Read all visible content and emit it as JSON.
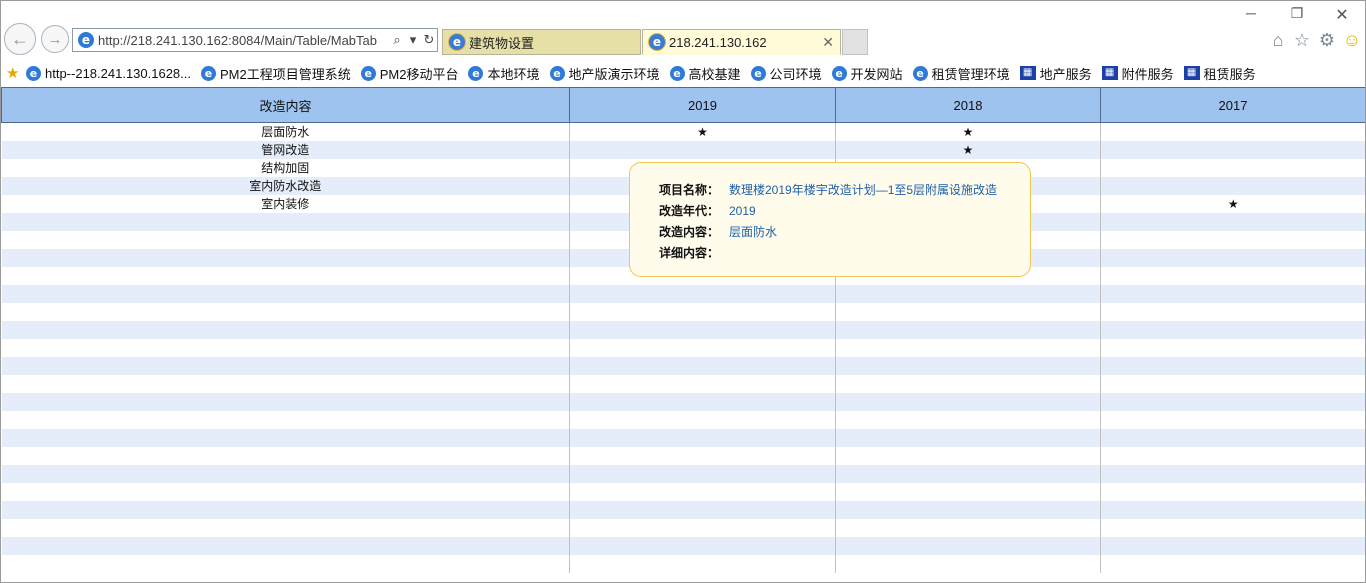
{
  "browser": {
    "address": "http://218.241.130.162:8084/Main/Table/MabTab",
    "tabs": [
      {
        "label": "建筑物设置"
      },
      {
        "label": "218.241.130.162"
      }
    ],
    "favorites": [
      {
        "label": "http--218.241.130.1628...",
        "icon": "ie-icon"
      },
      {
        "label": "PM2工程项目管理系统",
        "icon": "ie-icon"
      },
      {
        "label": "PM2移动平台",
        "icon": "ie-icon"
      },
      {
        "label": "本地环境",
        "icon": "ie-icon"
      },
      {
        "label": "地产版演示环境",
        "icon": "ie-icon"
      },
      {
        "label": "高校基建",
        "icon": "ie-icon"
      },
      {
        "label": "公司环境",
        "icon": "ie-icon"
      },
      {
        "label": "开发网站",
        "icon": "ie-icon"
      },
      {
        "label": "租赁管理环境",
        "icon": "ie-icon"
      },
      {
        "label": "地产服务",
        "icon": "service-icon"
      },
      {
        "label": "附件服务",
        "icon": "service-icon"
      },
      {
        "label": "租赁服务",
        "icon": "service-icon"
      }
    ]
  },
  "table": {
    "headers": [
      "改造内容",
      "2019",
      "2018",
      "2017"
    ],
    "rows": [
      {
        "name": "层面防水",
        "y2019": "★",
        "y2018": "★",
        "y2017": ""
      },
      {
        "name": "管网改造",
        "y2019": "",
        "y2018": "★",
        "y2017": ""
      },
      {
        "name": "结构加固",
        "y2019": "",
        "y2018": "",
        "y2017": ""
      },
      {
        "name": "室内防水改造",
        "y2019": "",
        "y2018": "",
        "y2017": ""
      },
      {
        "name": "室内装修",
        "y2019": "",
        "y2018": "",
        "y2017": "★"
      }
    ]
  },
  "tooltip": {
    "project_label": "项目名称：",
    "project_value": "数理楼2019年楼宇改造计划—1至5层附属设施改造",
    "year_label": "改造年代：",
    "year_value": "2019",
    "content_label": "改造内容：",
    "content_value": "层面防水",
    "detail_label": "详细内容：",
    "detail_value": ""
  },
  "colors": {
    "header_bg": "#9dc3ee",
    "stripe": "#e5edfb",
    "tooltip_bg": "#fffcec",
    "tooltip_border": "#f0c850",
    "tooltip_value": "#1f5fa8"
  }
}
